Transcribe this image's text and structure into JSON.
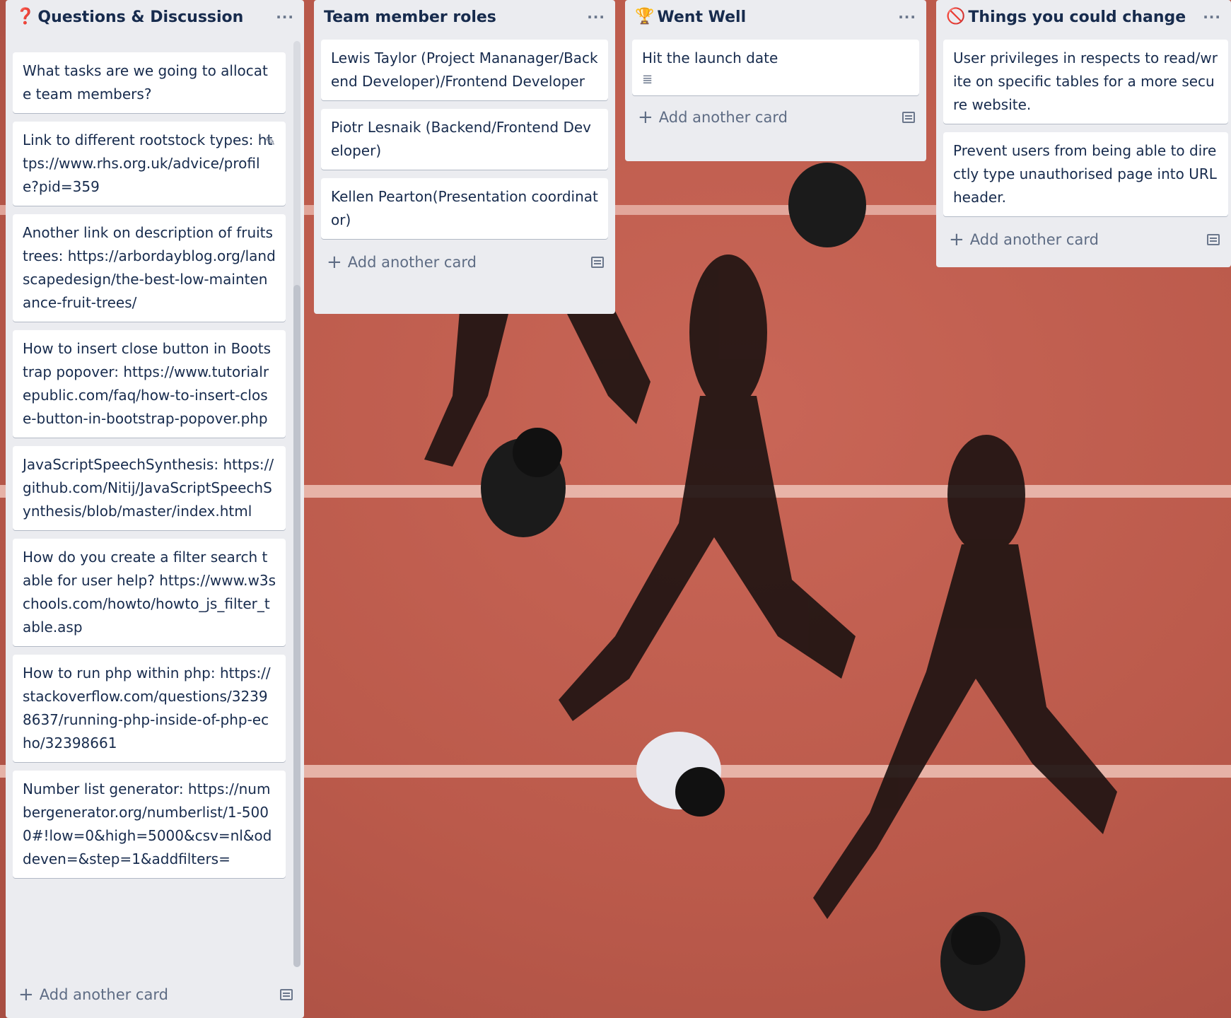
{
  "lists": [
    {
      "title": "Questions & Discussion",
      "icon": "question-mark-icon",
      "cards": [
        "What tasks are we going to allocate team members?",
        "Link to different rootstock types: https://www.rhs.org.uk/advice/profile?pid=359",
        "Another link on description of fruits trees: https://arbordayblog.org/landscapedesign/the-best-low-maintenance-fruit-trees/",
        "How to insert close button in Bootstrap popover: https://www.tutorialrepublic.com/faq/how-to-insert-close-button-in-bootstrap-popover.php",
        "JavaScriptSpeechSynthesis: https://github.com/Nitij/JavaScriptSpeechSynthesis/blob/master/index.html",
        "How do you create a filter search table for user help? https://www.w3schools.com/howto/howto_js_filter_table.asp",
        "How to run php within php: https://stackoverflow.com/questions/32398637/running-php-inside-of-php-echo/32398661",
        "Number list generator: https://numbergenerator.org/numberlist/1-5000#!low=0&high=5000&csv=nl&oddeven=&step=1&addfilters="
      ],
      "add_label": "Add another card"
    },
    {
      "title": "Team member roles",
      "icon": "",
      "cards": [
        "Lewis Taylor (Project Mananager/Backend Developer)/Frontend Developer",
        "Piotr Lesnaik (Backend/Frontend Developer)",
        "Kellen Pearton(Presentation coordinator)"
      ],
      "add_label": "Add another card"
    },
    {
      "title": "Went Well",
      "icon": "trophy-icon",
      "cards": [
        "Hit the launch date"
      ],
      "add_label": "Add another card"
    },
    {
      "title": "Things you could change",
      "icon": "no-entry-icon",
      "cards": [
        "User privileges in respects to read/write on specific tables for a more secure website.",
        "Prevent users from being able to directly type unauthorised page into URL header."
      ],
      "add_label": "Add another card"
    }
  ],
  "colors": {
    "list_bg": "#ebecf0",
    "card_bg": "#ffffff",
    "text": "#172b4d",
    "muted": "#5e6c84",
    "track": "#bb5a4b"
  }
}
